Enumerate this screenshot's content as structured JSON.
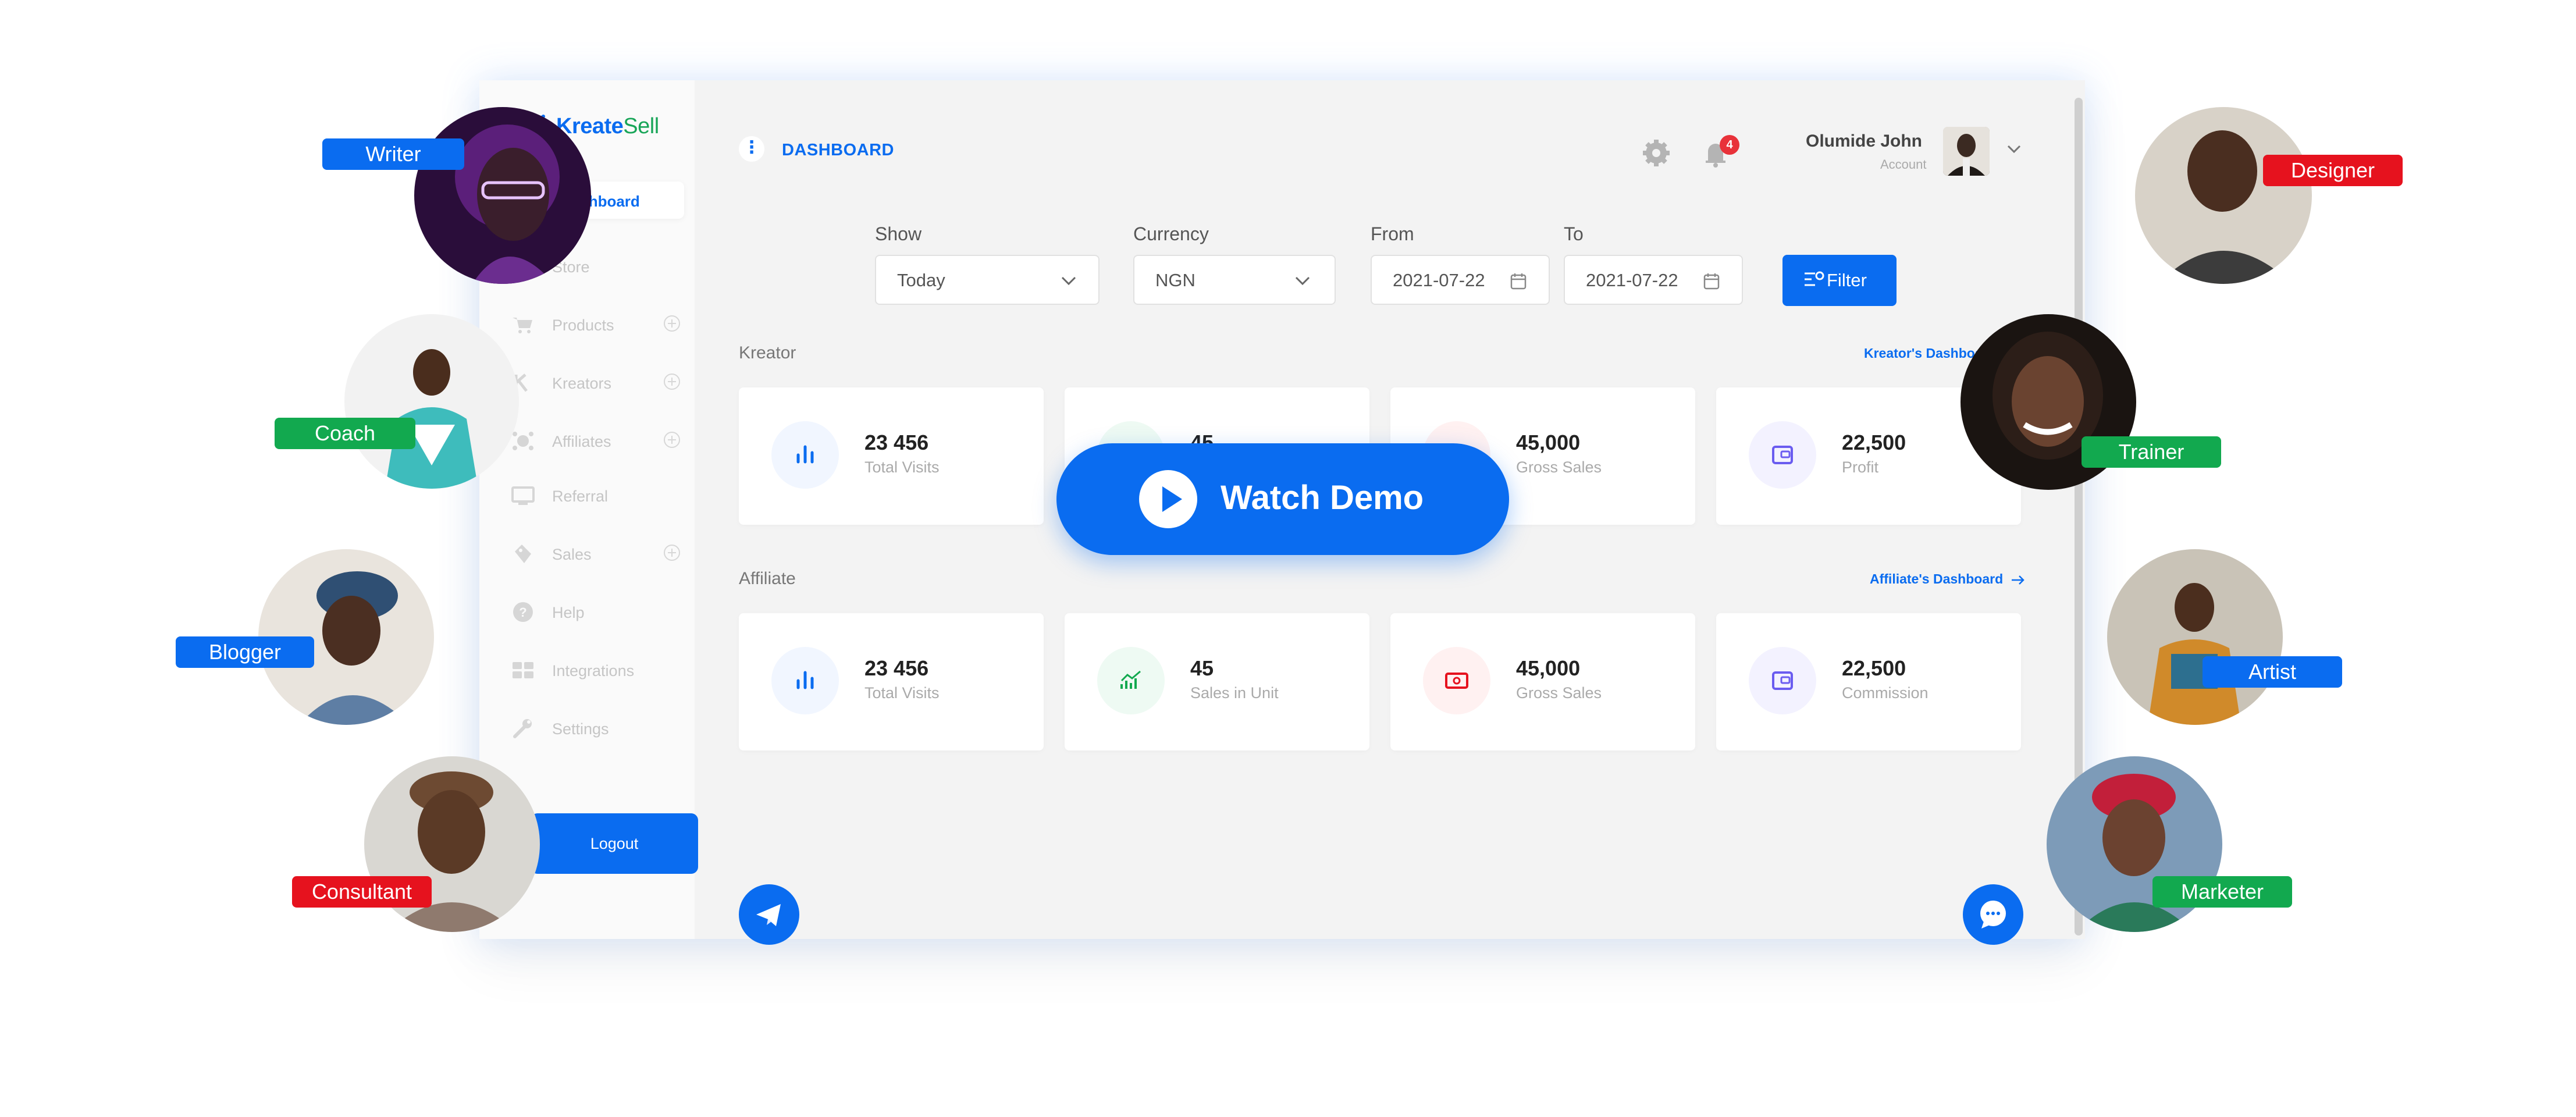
{
  "app": {
    "brand_prefix": "Kreate",
    "brand_suffix": "Sell"
  },
  "sidebar": {
    "active_label": "Dashboard",
    "items": [
      {
        "label": "Store",
        "icon": "store-icon"
      },
      {
        "label": "Products",
        "icon": "cart-icon",
        "has_add": true
      },
      {
        "label": "Kreators",
        "icon": "kreators-icon",
        "has_add": true
      },
      {
        "label": "Affiliates",
        "icon": "affiliates-icon",
        "has_add": true
      },
      {
        "label": "Referral",
        "icon": "referral-icon"
      },
      {
        "label": "Sales",
        "icon": "sales-icon",
        "has_add": true
      },
      {
        "label": "Help",
        "icon": "help-icon"
      },
      {
        "label": "Integrations",
        "icon": "integrations-icon"
      },
      {
        "label": "Settings",
        "icon": "wrench-icon"
      }
    ],
    "logout_label": "Logout"
  },
  "header": {
    "title": "DASHBOARD",
    "notification_count": "4",
    "user_name": "Olumide John",
    "user_role": "Account"
  },
  "filters": {
    "show_label": "Show",
    "show_value": "Today",
    "currency_label": "Currency",
    "currency_value": "NGN",
    "from_label": "From",
    "from_value": "2021-07-22",
    "to_label": "To",
    "to_value": "2021-07-22",
    "filter_button": "Filter"
  },
  "kreator": {
    "title": "Kreator",
    "link": "Kreator's Dashboard",
    "cards": [
      {
        "value": "23 456",
        "caption": "Total Visits"
      },
      {
        "value": "45",
        "caption": ""
      },
      {
        "value": "45,000",
        "caption": "Gross Sales"
      },
      {
        "value": "22,500",
        "caption": "Profit"
      }
    ]
  },
  "affiliate": {
    "title": "Affiliate",
    "link": "Affiliate's Dashboard",
    "cards": [
      {
        "value": "23 456",
        "caption": "Total Visits"
      },
      {
        "value": "45",
        "caption": "Sales in Unit"
      },
      {
        "value": "45,000",
        "caption": "Gross Sales"
      },
      {
        "value": "22,500",
        "caption": "Commission"
      }
    ]
  },
  "watch_demo": {
    "label": "Watch Demo"
  },
  "colors": {
    "primary": "#0a6cf0",
    "green": "#12a94f",
    "red": "#e6121e"
  },
  "roles": [
    {
      "label": "Writer",
      "color": "#0a6cf0"
    },
    {
      "label": "Coach",
      "color": "#12a94f"
    },
    {
      "label": "Blogger",
      "color": "#0a6cf0"
    },
    {
      "label": "Consultant",
      "color": "#e6121e"
    },
    {
      "label": "Designer",
      "color": "#e6121e"
    },
    {
      "label": "Trainer",
      "color": "#12a94f"
    },
    {
      "label": "Artist",
      "color": "#0a6cf0"
    },
    {
      "label": "Marketer",
      "color": "#12a94f"
    }
  ]
}
